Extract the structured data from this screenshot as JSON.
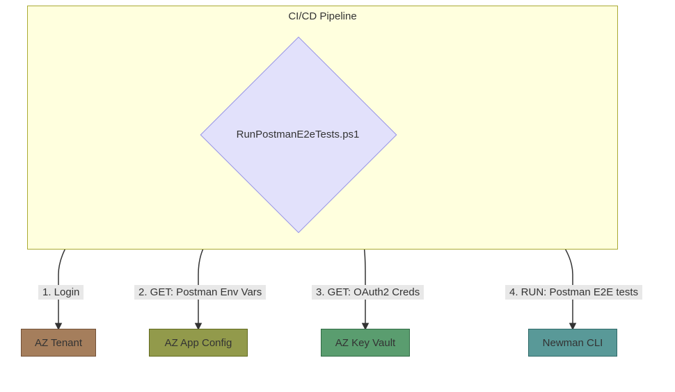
{
  "container": {
    "title": "CI/CD Pipeline"
  },
  "nodes": {
    "script": {
      "label": "RunPostmanE2eTests.ps1"
    },
    "tenant": {
      "label": "AZ Tenant"
    },
    "appconfig": {
      "label": "AZ App Config"
    },
    "keyvault": {
      "label": "AZ Key Vault"
    },
    "newman": {
      "label": "Newman CLI"
    }
  },
  "edges": {
    "login": {
      "label": "1. Login"
    },
    "envvars": {
      "label": "2. GET: Postman Env Vars"
    },
    "creds": {
      "label": "3. GET: OAuth2 Creds"
    },
    "run": {
      "label": "4. RUN: Postman E2E tests"
    }
  }
}
